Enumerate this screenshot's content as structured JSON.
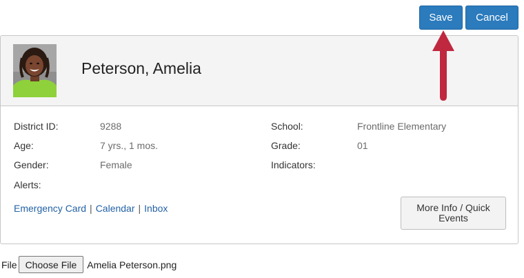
{
  "toolbar": {
    "save_label": "Save",
    "cancel_label": "Cancel",
    "save_color": "#2b7bbd"
  },
  "annotation": {
    "arrow_color": "#c0283f",
    "arrow_icon": "arrow-up-icon"
  },
  "student": {
    "name": "Peterson, Amelia",
    "photo_icon": "student-photo",
    "fields": {
      "district_id_label": "District ID:",
      "district_id_value": "9288",
      "age_label": "Age:",
      "age_value": "7 yrs., 1 mos.",
      "gender_label": "Gender:",
      "gender_value": "Female",
      "alerts_label": "Alerts:",
      "school_label": "School:",
      "school_value": "Frontline Elementary",
      "grade_label": "Grade:",
      "grade_value": "01",
      "indicators_label": "Indicators:"
    },
    "links": {
      "emergency_card": "Emergency Card",
      "calendar": "Calendar",
      "inbox": "Inbox",
      "separator": "|"
    },
    "more_info_label": "More Info / Quick Events"
  },
  "file_upload": {
    "label": "File",
    "button_label": "Choose File",
    "file_name": "Amelia Peterson.png"
  }
}
